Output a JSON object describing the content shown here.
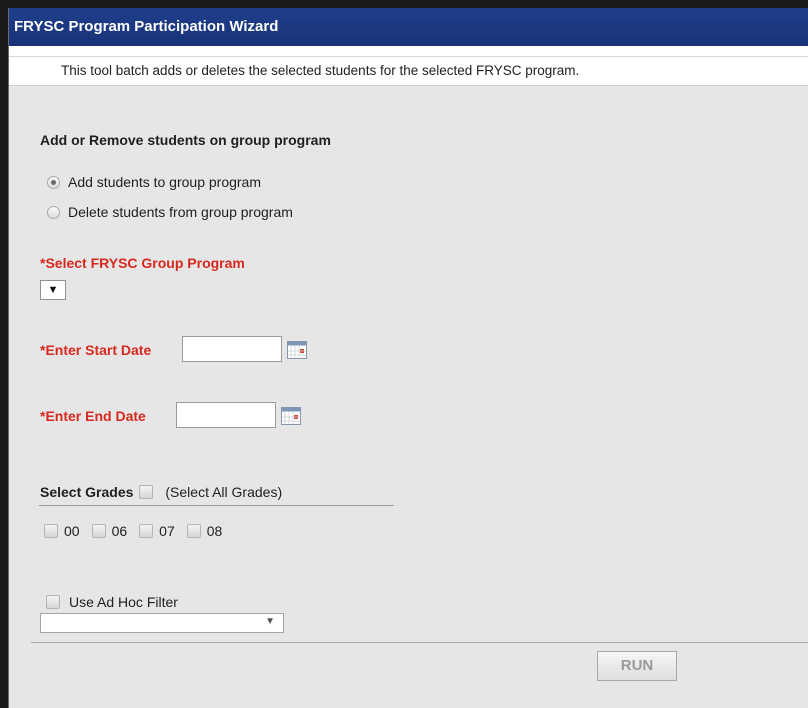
{
  "window": {
    "title": "FRYSC Program Participation Wizard"
  },
  "description": "This tool batch adds or deletes the selected students for the selected FRYSC program.",
  "mode_section": {
    "heading": "Add or Remove students on group program",
    "options": [
      {
        "label": "Add students to group program",
        "selected": true
      },
      {
        "label": "Delete students from group program",
        "selected": false
      }
    ]
  },
  "group_program": {
    "label": "*Select FRYSC Group Program",
    "dropdown_glyph": "▼",
    "selected_value": ""
  },
  "start_date": {
    "label": "*Enter Start Date",
    "value": "",
    "icon": "calendar-icon"
  },
  "end_date": {
    "label": "*Enter End Date",
    "value": "",
    "icon": "calendar-icon"
  },
  "grades": {
    "heading": "Select Grades",
    "select_all_label": "(Select All Grades)",
    "items": [
      {
        "label": "00",
        "checked": false
      },
      {
        "label": "06",
        "checked": false
      },
      {
        "label": "07",
        "checked": false
      },
      {
        "label": "08",
        "checked": false
      }
    ]
  },
  "adhoc": {
    "label": "Use Ad Hoc Filter",
    "checked": false,
    "selected_value": "",
    "arrow_glyph": "▼"
  },
  "actions": {
    "run_label": "RUN",
    "run_enabled": false
  },
  "colors": {
    "title_bar": "#1f3f8c",
    "required_label": "#d8281f",
    "panel_background": "#e6e6e6"
  }
}
